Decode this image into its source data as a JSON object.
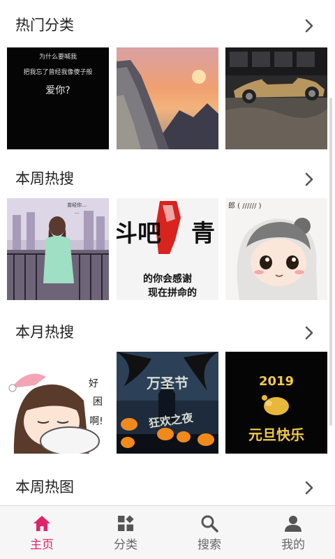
{
  "sections": [
    {
      "title": "热门分类",
      "images": [
        {
          "name": "text-love-image",
          "lines": [
            "为什么要喊我",
            "把我忘了曾经我像傻子般",
            "爱你?"
          ]
        },
        {
          "name": "mountain-sunset-image"
        },
        {
          "name": "sports-car-image"
        }
      ]
    },
    {
      "title": "本周热搜",
      "images": [
        {
          "name": "girl-railing-image",
          "lines": [
            "曾经你...",
            "..."
          ]
        },
        {
          "name": "fist-slogan-image",
          "lines": [
            "斗吧",
            "青",
            "的你会感谢",
            "现在拼命的"
          ]
        },
        {
          "name": "cartoon-girl-image",
          "lines": [
            "郎 ( ////// )"
          ]
        }
      ]
    },
    {
      "title": "本月热搜",
      "images": [
        {
          "name": "sleepy-girl-image",
          "lines": [
            "好",
            "困",
            "啊!"
          ]
        },
        {
          "name": "halloween-image",
          "lines": [
            "万圣节",
            "狂欢之夜"
          ]
        },
        {
          "name": "new-year-2019-image",
          "lines": [
            "2019",
            "元旦快乐"
          ]
        }
      ]
    },
    {
      "title": "本周热图"
    }
  ],
  "nav": [
    {
      "label": "主页",
      "icon": "home-icon"
    },
    {
      "label": "分类",
      "icon": "category-icon"
    },
    {
      "label": "搜索",
      "icon": "search-icon"
    },
    {
      "label": "我的",
      "icon": "profile-icon"
    }
  ],
  "colors": {
    "accent": "#e0226b",
    "nav_inactive": "#666666",
    "nav_icon": "#555555"
  }
}
